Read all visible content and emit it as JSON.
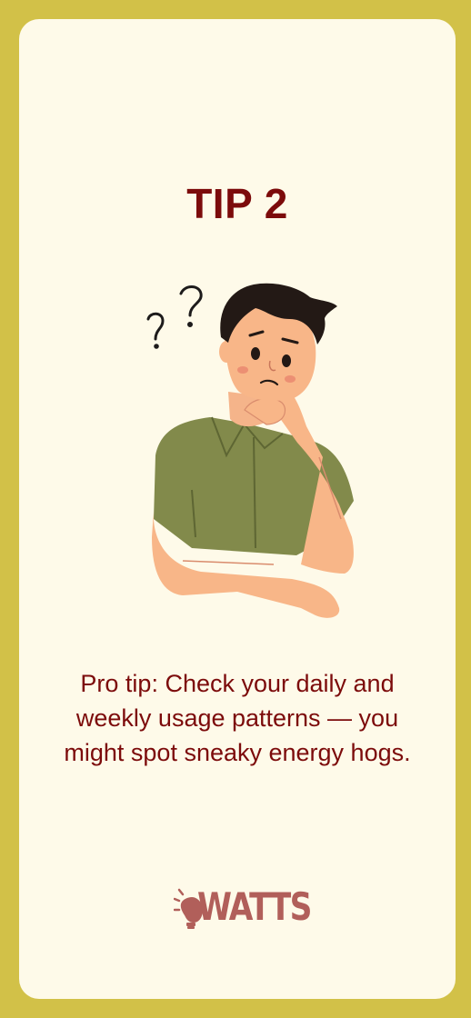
{
  "card": {
    "title": "TIP 2",
    "tip_text": "Pro tip: Check your daily and weekly usage patterns — you might spot sneaky energy hogs.",
    "illustration": "thinking-man-illustration"
  },
  "brand": {
    "logo_text": "WATTS",
    "logo_icon": "lightbulb-icon"
  },
  "colors": {
    "frame": "#d2c148",
    "card_background": "#fefae9",
    "text_accent": "#7c0b0b",
    "logo": "#b15f5a"
  }
}
